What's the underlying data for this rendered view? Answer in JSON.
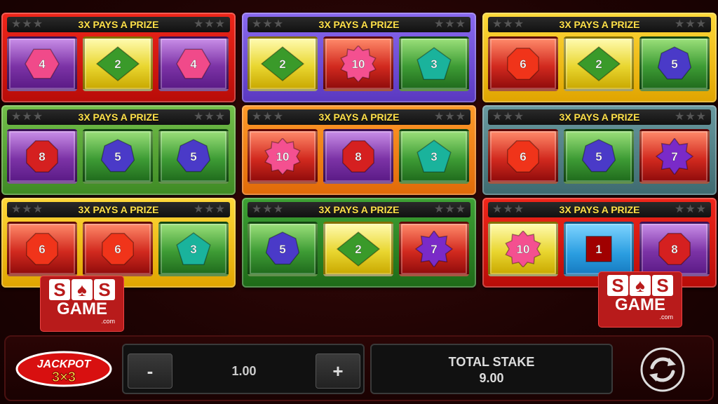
{
  "colors": {
    "red": "#e21b10",
    "purple": "#7a4fe0",
    "yellow": "#f0c21a",
    "green": "#5cae3a",
    "orange": "#f0841a",
    "teal": "#5a8a90",
    "darkgreen": "#2f8a2a"
  },
  "banner_text": "3X PAYS A PRIZE",
  "cards": [
    {
      "frame": "red",
      "cells": [
        {
          "bg": "purple",
          "shape": "hexagon",
          "fill": "#f04a8a",
          "value": "4"
        },
        {
          "bg": "yellow",
          "shape": "diamond",
          "fill": "#3a9a2a",
          "value": "2"
        },
        {
          "bg": "purple",
          "shape": "hexagon",
          "fill": "#f04a8a",
          "value": "4"
        }
      ]
    },
    {
      "frame": "purple",
      "cells": [
        {
          "bg": "yellow",
          "shape": "diamond",
          "fill": "#3a9a2a",
          "value": "2"
        },
        {
          "bg": "red",
          "shape": "star",
          "fill": "#f45090",
          "value": "10"
        },
        {
          "bg": "green",
          "shape": "pentagon",
          "fill": "#1ab39c",
          "value": "3"
        }
      ]
    },
    {
      "frame": "yellow",
      "cells": [
        {
          "bg": "red",
          "shape": "octagon",
          "fill": "#f0341a",
          "value": "6"
        },
        {
          "bg": "yellow",
          "shape": "diamond",
          "fill": "#3a9a2a",
          "value": "2"
        },
        {
          "bg": "green",
          "shape": "heptagon",
          "fill": "#4a3ac8",
          "value": "5"
        }
      ]
    },
    {
      "frame": "green",
      "cells": [
        {
          "bg": "purple",
          "shape": "octagon",
          "fill": "#d52020",
          "value": "8"
        },
        {
          "bg": "green",
          "shape": "heptagon",
          "fill": "#4a3ac8",
          "value": "5"
        },
        {
          "bg": "green",
          "shape": "heptagon",
          "fill": "#4a3ac8",
          "value": "5"
        }
      ]
    },
    {
      "frame": "orange",
      "cells": [
        {
          "bg": "red",
          "shape": "star",
          "fill": "#f45090",
          "value": "10"
        },
        {
          "bg": "purple",
          "shape": "octagon",
          "fill": "#d52020",
          "value": "8"
        },
        {
          "bg": "green",
          "shape": "pentagon",
          "fill": "#1ab39c",
          "value": "3"
        }
      ]
    },
    {
      "frame": "teal",
      "cells": [
        {
          "bg": "red",
          "shape": "octagon",
          "fill": "#f0341a",
          "value": "6"
        },
        {
          "bg": "green",
          "shape": "heptagon",
          "fill": "#4a3ac8",
          "value": "5"
        },
        {
          "bg": "red",
          "shape": "star8",
          "fill": "#7a2ac8",
          "value": "7"
        }
      ]
    },
    {
      "frame": "yellow",
      "cells": [
        {
          "bg": "red",
          "shape": "octagon",
          "fill": "#f0341a",
          "value": "6"
        },
        {
          "bg": "red",
          "shape": "octagon",
          "fill": "#f0341a",
          "value": "6"
        },
        {
          "bg": "green",
          "shape": "pentagon",
          "fill": "#1ab39c",
          "value": "3"
        }
      ]
    },
    {
      "frame": "darkgreen",
      "cells": [
        {
          "bg": "green",
          "shape": "heptagon",
          "fill": "#4a3ac8",
          "value": "5"
        },
        {
          "bg": "yellow",
          "shape": "diamond",
          "fill": "#3a9a2a",
          "value": "2"
        },
        {
          "bg": "red",
          "shape": "star8",
          "fill": "#7a2ac8",
          "value": "7"
        }
      ]
    },
    {
      "frame": "red",
      "cells": [
        {
          "bg": "yellow",
          "shape": "star",
          "fill": "#f45090",
          "value": "10"
        },
        {
          "bg": "blue",
          "shape": "square",
          "fill": "#a00000",
          "value": "1"
        },
        {
          "bg": "purple",
          "shape": "octagon",
          "fill": "#d52020",
          "value": "8"
        }
      ]
    }
  ],
  "logo": {
    "line1": [
      "S",
      "♠",
      "S"
    ],
    "line2": "GAME",
    "line3": ".com"
  },
  "controls": {
    "jackpot_word": "JACKPOT",
    "jackpot_3x3": "3×3",
    "minus": "-",
    "plus": "+",
    "stake": "1.00",
    "total_label": "TOTAL STAKE",
    "total_value": "9.00"
  }
}
